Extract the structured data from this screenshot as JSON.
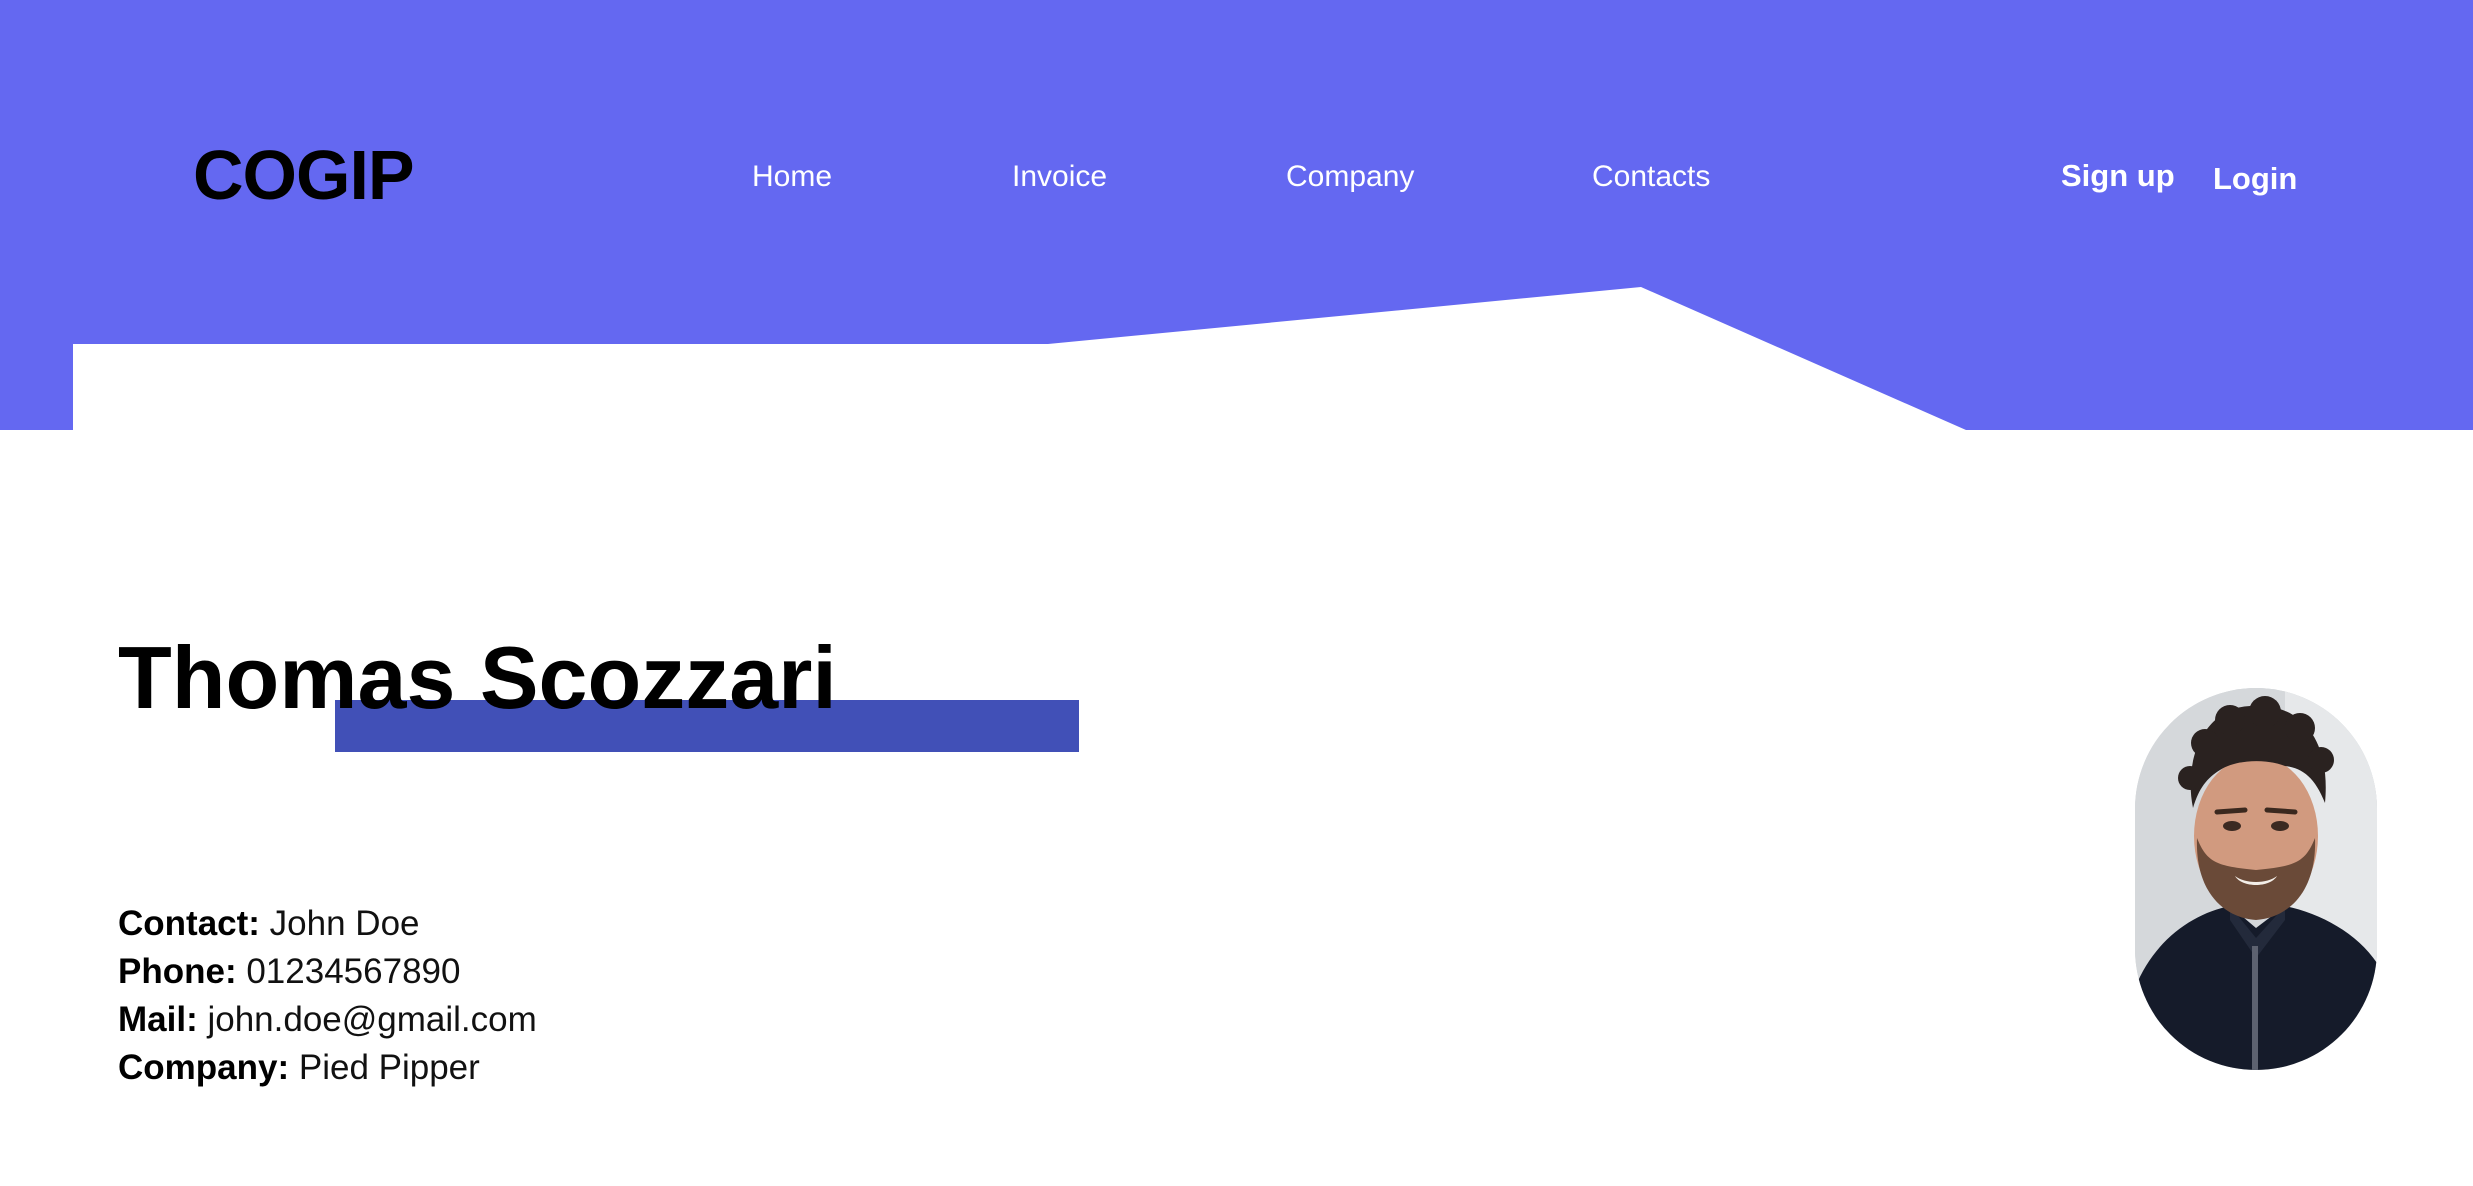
{
  "brand": {
    "logo_text": "COGIP",
    "accent_color": "#6468f1",
    "highlight_color": "#4150b7"
  },
  "nav": {
    "items": [
      {
        "label": "Home"
      },
      {
        "label": "Invoice"
      },
      {
        "label": "Company"
      },
      {
        "label": "Contacts"
      }
    ]
  },
  "auth": {
    "signup_label": "Sign up",
    "login_label": "Login"
  },
  "contact": {
    "name": "Thomas Scozzari",
    "fields": [
      {
        "label": "Contact:",
        "value": "John Doe"
      },
      {
        "label": "Phone:",
        "value": "01234567890"
      },
      {
        "label": "Mail:",
        "value": "john.doe@gmail.com"
      },
      {
        "label": "Company:",
        "value": "Pied Pipper"
      }
    ],
    "avatar_icon": "profile-photo"
  }
}
